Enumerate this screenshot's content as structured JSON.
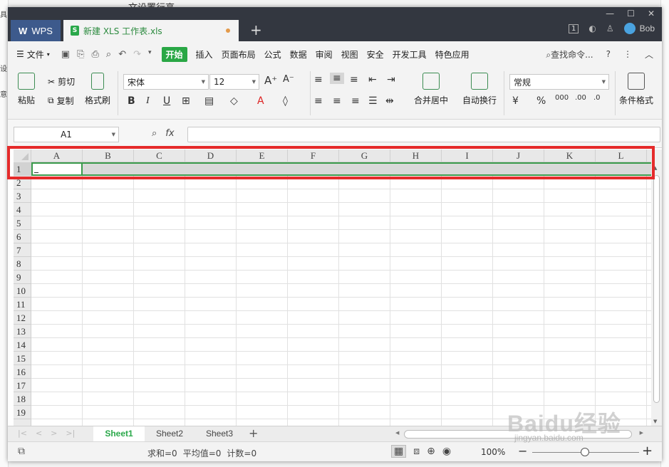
{
  "colors": {
    "accent": "#2aa84a",
    "highlight_border": "#e52b2b",
    "titlebar": "#333740"
  },
  "background": {
    "top_text": "文设置行高",
    "left_chars": [
      "具",
      "设",
      "意"
    ]
  },
  "titlebar": {
    "app_tab": "WPS",
    "doc_tab": "新建 XLS 工作表.xls",
    "badge": "1",
    "user": "Bob"
  },
  "menubar": {
    "file": "文件",
    "items": [
      "开始",
      "插入",
      "页面布局",
      "公式",
      "数据",
      "审阅",
      "视图",
      "安全",
      "开发工具",
      "特色应用"
    ],
    "search": "查找命令...",
    "help": "?"
  },
  "ribbon": {
    "paste": "粘贴",
    "cut": "剪切",
    "copy": "复制",
    "format_painter": "格式刷",
    "font_name": "宋体",
    "font_size": "12",
    "merge_center": "合并居中",
    "wrap_text": "自动换行",
    "number_format": "常规",
    "conditional_format": "条件格式"
  },
  "formulabar": {
    "name_box": "A1",
    "fx": "fx"
  },
  "grid": {
    "columns": [
      "A",
      "B",
      "C",
      "D",
      "E",
      "F",
      "G",
      "H",
      "I",
      "J",
      "K",
      "L"
    ],
    "rows": [
      "1",
      "2",
      "3",
      "4",
      "5",
      "6",
      "7",
      "8",
      "9",
      "10",
      "11",
      "12",
      "13",
      "14",
      "15",
      "16",
      "17",
      "18",
      "19"
    ]
  },
  "sheets": [
    "Sheet1",
    "Sheet2",
    "Sheet3"
  ],
  "statusbar": {
    "sum": "求和=0",
    "avg": "平均值=0",
    "count": "计数=0",
    "zoom": "100%"
  },
  "watermark": {
    "brand": "Baidu经验",
    "url": "jingyan.baidu.com"
  }
}
